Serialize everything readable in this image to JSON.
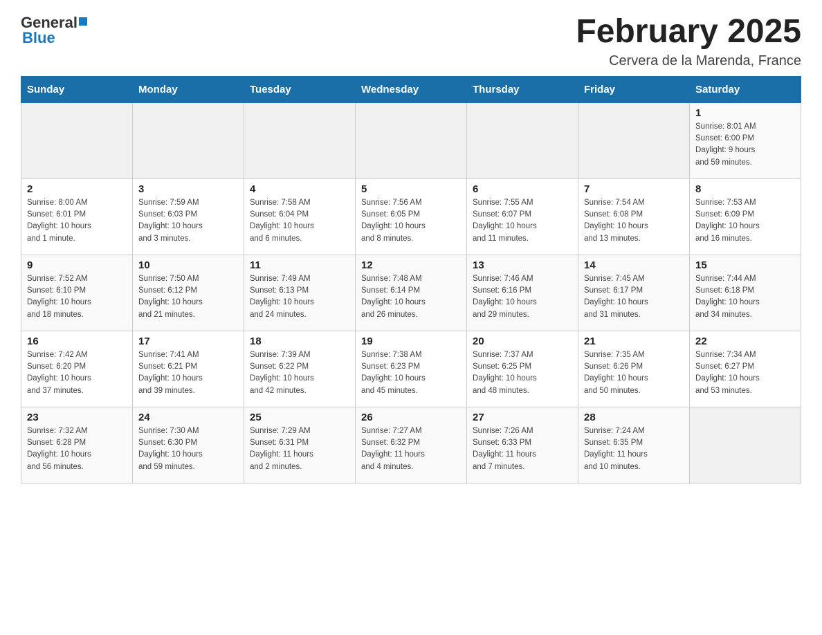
{
  "header": {
    "logo_general": "General",
    "logo_blue": "Blue",
    "title": "February 2025",
    "subtitle": "Cervera de la Marenda, France"
  },
  "weekdays": [
    "Sunday",
    "Monday",
    "Tuesday",
    "Wednesday",
    "Thursday",
    "Friday",
    "Saturday"
  ],
  "weeks": [
    {
      "days": [
        {
          "num": "",
          "info": ""
        },
        {
          "num": "",
          "info": ""
        },
        {
          "num": "",
          "info": ""
        },
        {
          "num": "",
          "info": ""
        },
        {
          "num": "",
          "info": ""
        },
        {
          "num": "",
          "info": ""
        },
        {
          "num": "1",
          "info": "Sunrise: 8:01 AM\nSunset: 6:00 PM\nDaylight: 9 hours\nand 59 minutes."
        }
      ]
    },
    {
      "days": [
        {
          "num": "2",
          "info": "Sunrise: 8:00 AM\nSunset: 6:01 PM\nDaylight: 10 hours\nand 1 minute."
        },
        {
          "num": "3",
          "info": "Sunrise: 7:59 AM\nSunset: 6:03 PM\nDaylight: 10 hours\nand 3 minutes."
        },
        {
          "num": "4",
          "info": "Sunrise: 7:58 AM\nSunset: 6:04 PM\nDaylight: 10 hours\nand 6 minutes."
        },
        {
          "num": "5",
          "info": "Sunrise: 7:56 AM\nSunset: 6:05 PM\nDaylight: 10 hours\nand 8 minutes."
        },
        {
          "num": "6",
          "info": "Sunrise: 7:55 AM\nSunset: 6:07 PM\nDaylight: 10 hours\nand 11 minutes."
        },
        {
          "num": "7",
          "info": "Sunrise: 7:54 AM\nSunset: 6:08 PM\nDaylight: 10 hours\nand 13 minutes."
        },
        {
          "num": "8",
          "info": "Sunrise: 7:53 AM\nSunset: 6:09 PM\nDaylight: 10 hours\nand 16 minutes."
        }
      ]
    },
    {
      "days": [
        {
          "num": "9",
          "info": "Sunrise: 7:52 AM\nSunset: 6:10 PM\nDaylight: 10 hours\nand 18 minutes."
        },
        {
          "num": "10",
          "info": "Sunrise: 7:50 AM\nSunset: 6:12 PM\nDaylight: 10 hours\nand 21 minutes."
        },
        {
          "num": "11",
          "info": "Sunrise: 7:49 AM\nSunset: 6:13 PM\nDaylight: 10 hours\nand 24 minutes."
        },
        {
          "num": "12",
          "info": "Sunrise: 7:48 AM\nSunset: 6:14 PM\nDaylight: 10 hours\nand 26 minutes."
        },
        {
          "num": "13",
          "info": "Sunrise: 7:46 AM\nSunset: 6:16 PM\nDaylight: 10 hours\nand 29 minutes."
        },
        {
          "num": "14",
          "info": "Sunrise: 7:45 AM\nSunset: 6:17 PM\nDaylight: 10 hours\nand 31 minutes."
        },
        {
          "num": "15",
          "info": "Sunrise: 7:44 AM\nSunset: 6:18 PM\nDaylight: 10 hours\nand 34 minutes."
        }
      ]
    },
    {
      "days": [
        {
          "num": "16",
          "info": "Sunrise: 7:42 AM\nSunset: 6:20 PM\nDaylight: 10 hours\nand 37 minutes."
        },
        {
          "num": "17",
          "info": "Sunrise: 7:41 AM\nSunset: 6:21 PM\nDaylight: 10 hours\nand 39 minutes."
        },
        {
          "num": "18",
          "info": "Sunrise: 7:39 AM\nSunset: 6:22 PM\nDaylight: 10 hours\nand 42 minutes."
        },
        {
          "num": "19",
          "info": "Sunrise: 7:38 AM\nSunset: 6:23 PM\nDaylight: 10 hours\nand 45 minutes."
        },
        {
          "num": "20",
          "info": "Sunrise: 7:37 AM\nSunset: 6:25 PM\nDaylight: 10 hours\nand 48 minutes."
        },
        {
          "num": "21",
          "info": "Sunrise: 7:35 AM\nSunset: 6:26 PM\nDaylight: 10 hours\nand 50 minutes."
        },
        {
          "num": "22",
          "info": "Sunrise: 7:34 AM\nSunset: 6:27 PM\nDaylight: 10 hours\nand 53 minutes."
        }
      ]
    },
    {
      "days": [
        {
          "num": "23",
          "info": "Sunrise: 7:32 AM\nSunset: 6:28 PM\nDaylight: 10 hours\nand 56 minutes."
        },
        {
          "num": "24",
          "info": "Sunrise: 7:30 AM\nSunset: 6:30 PM\nDaylight: 10 hours\nand 59 minutes."
        },
        {
          "num": "25",
          "info": "Sunrise: 7:29 AM\nSunset: 6:31 PM\nDaylight: 11 hours\nand 2 minutes."
        },
        {
          "num": "26",
          "info": "Sunrise: 7:27 AM\nSunset: 6:32 PM\nDaylight: 11 hours\nand 4 minutes."
        },
        {
          "num": "27",
          "info": "Sunrise: 7:26 AM\nSunset: 6:33 PM\nDaylight: 11 hours\nand 7 minutes."
        },
        {
          "num": "28",
          "info": "Sunrise: 7:24 AM\nSunset: 6:35 PM\nDaylight: 11 hours\nand 10 minutes."
        },
        {
          "num": "",
          "info": ""
        }
      ]
    }
  ]
}
